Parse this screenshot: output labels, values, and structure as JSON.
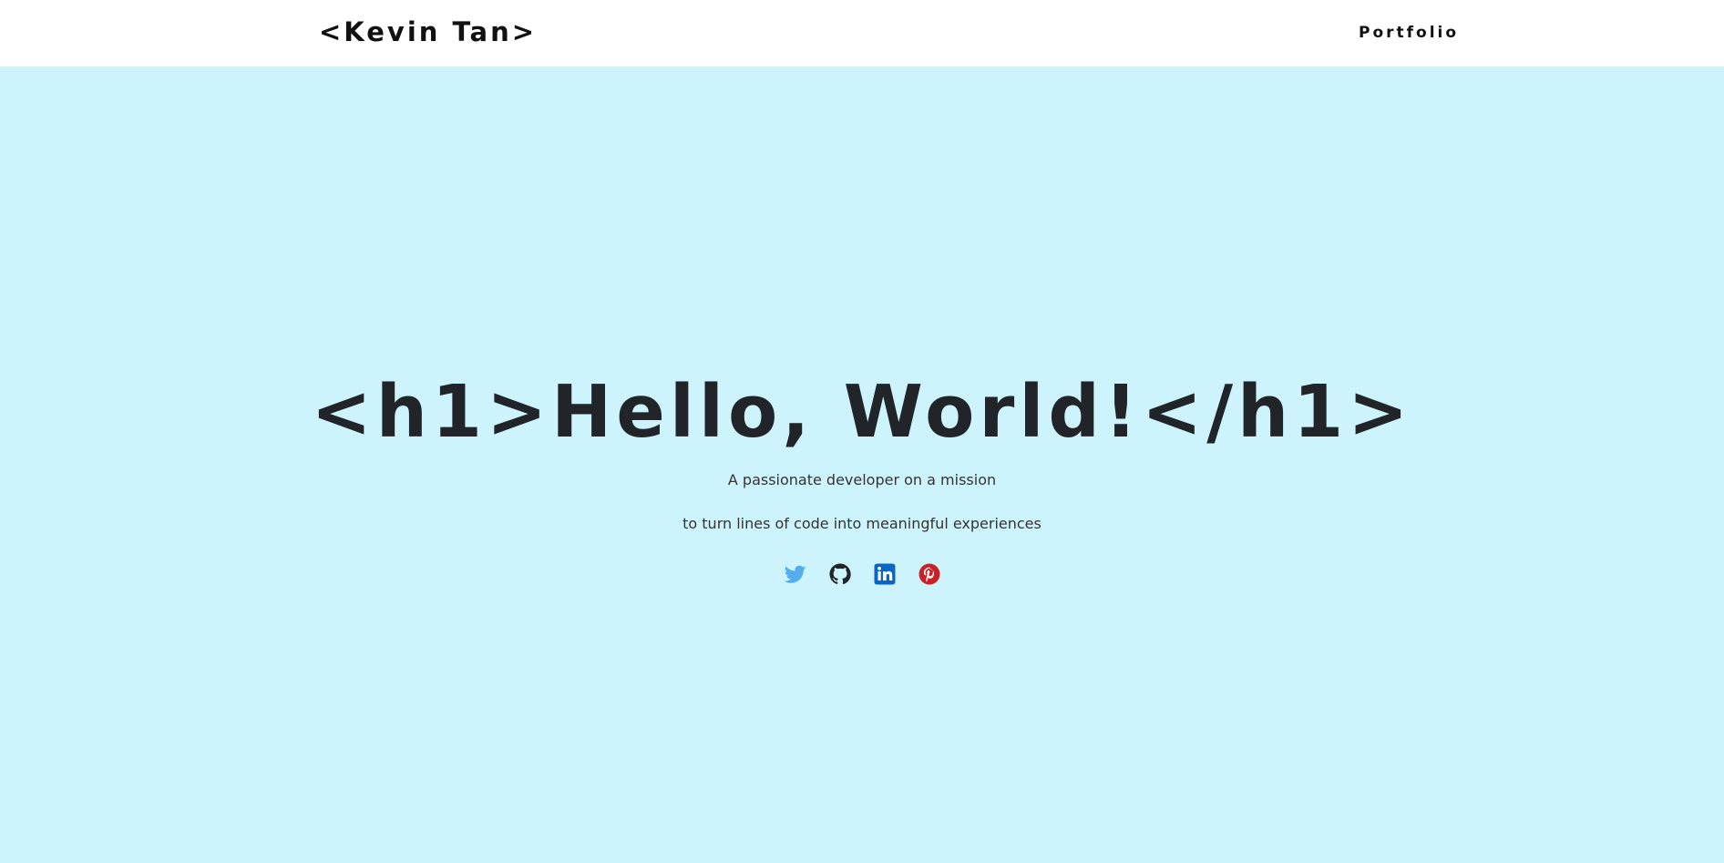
{
  "navbar": {
    "brand": "<Kevin Tan>",
    "links": [
      {
        "label": "Portfolio"
      }
    ]
  },
  "hero": {
    "title": "<h1>Hello, World!</h1>",
    "line1": "A passionate developer on a mission",
    "line2": "to turn lines of code into meaningful experiences",
    "background_color": "#cdf4fc",
    "socials": [
      {
        "icon": "twitter-icon",
        "color": "#55acee"
      },
      {
        "icon": "github-icon",
        "color": "#212529"
      },
      {
        "icon": "linkedin-icon",
        "color": "#0a66c2"
      },
      {
        "icon": "pinterest-icon",
        "color": "#cb2027"
      }
    ]
  }
}
